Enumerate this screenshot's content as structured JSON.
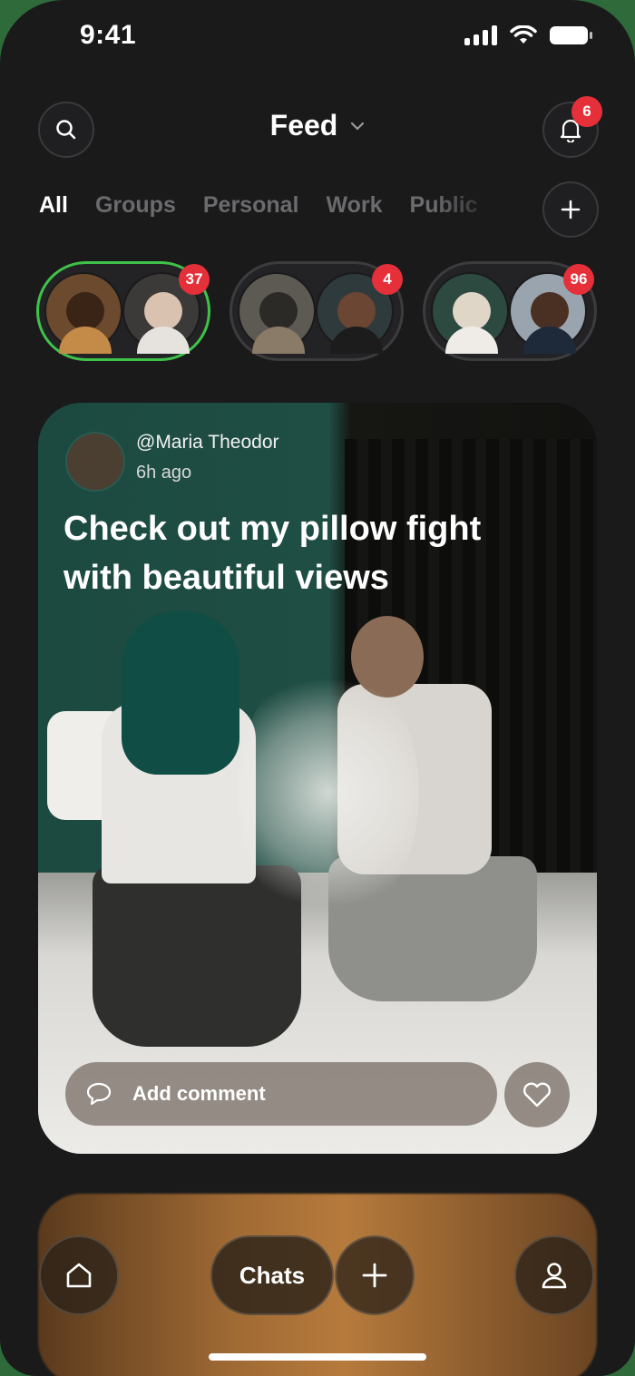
{
  "status_bar": {
    "time": "9:41"
  },
  "header": {
    "title": "Feed",
    "notification_count": "6"
  },
  "tabs": [
    {
      "label": "All",
      "active": true
    },
    {
      "label": "Groups",
      "active": false
    },
    {
      "label": "Personal",
      "active": false
    },
    {
      "label": "Work",
      "active": false
    },
    {
      "label": "Public",
      "active": false
    }
  ],
  "groups": [
    {
      "count": "37",
      "selected": true
    },
    {
      "count": "4",
      "selected": false
    },
    {
      "count": "96",
      "selected": false
    }
  ],
  "post": {
    "author": "@Maria Theodor",
    "time": "6h ago",
    "text": "Check out my pillow fight with beautiful views",
    "comment_placeholder": "Add comment"
  },
  "bottom_nav": {
    "chats_label": "Chats"
  },
  "colors": {
    "selected_group": "#3fc24a",
    "badge": "#e5303a",
    "background": "#1a1a1b"
  }
}
